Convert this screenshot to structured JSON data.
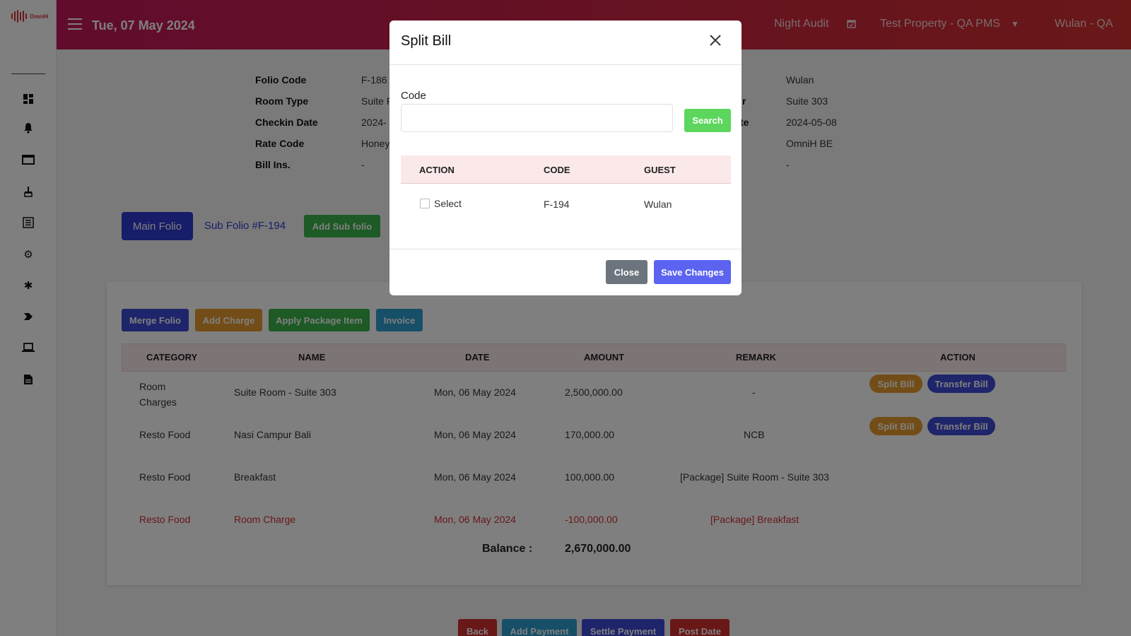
{
  "app": {
    "logo_text": "OmniH"
  },
  "topbar": {
    "date": "Tue, 07 May 2024",
    "night_audit": "Night Audit",
    "property": "Test Property - QA PMS",
    "user": "Wulan - QA"
  },
  "sidebar": {
    "icons": [
      "dashboard-icon",
      "bell-icon",
      "folder-icon",
      "broom-icon",
      "list-icon",
      "gear-icon",
      "network-icon",
      "tag-icon",
      "laptop-icon",
      "report-icon"
    ]
  },
  "folio_info": {
    "left": [
      {
        "label": "Folio Code",
        "value": "F-186"
      },
      {
        "label": "Room Type",
        "value": "Suite R"
      },
      {
        "label": "Checkin Date",
        "value": "2024-"
      },
      {
        "label": "Rate Code",
        "value": "Honey"
      },
      {
        "label": "Bill Ins.",
        "value": "-"
      }
    ],
    "right": [
      {
        "label": "r",
        "value": "Wulan"
      },
      {
        "label": "r",
        "value": "Suite 303"
      },
      {
        "label": "te",
        "value": "2024-05-08"
      },
      {
        "label": "",
        "value": "OmniH BE"
      },
      {
        "label": "",
        "value": "-"
      }
    ]
  },
  "tabs": {
    "main": "Main Folio",
    "sub": "Sub Folio #F-194",
    "add_sub": "Add Sub folio"
  },
  "actions": {
    "merge": "Merge Folio",
    "add_charge": "Add Charge",
    "apply_package": "Apply Package Item",
    "invoice": "Invoice"
  },
  "table": {
    "headers": [
      "CATEGORY",
      "NAME",
      "DATE",
      "AMOUNT",
      "REMARK",
      "ACTION"
    ],
    "rows": [
      {
        "category": "Room\nCharges",
        "name": "Suite Room - Suite 303",
        "date": "Mon, 06 May 2024",
        "amount": "2,500,000.00",
        "remark": "-",
        "split": "Split Bill",
        "transfer": "Transfer Bill"
      },
      {
        "category": "Resto Food",
        "name": "Nasi Campur Bali",
        "date": "Mon, 06 May 2024",
        "amount": "170,000.00",
        "remark": "NCB",
        "split": "Split Bill",
        "transfer": "Transfer Bill"
      },
      {
        "category": "Resto Food",
        "name": "Breakfast",
        "date": "Mon, 06 May 2024",
        "amount": "100,000.00",
        "remark": "[Package] Suite Room - Suite 303"
      },
      {
        "category": "Resto Food",
        "name": "Room Charge",
        "date": "Mon, 06 May 2024",
        "amount": "-100,000.00",
        "remark": "[Package] Breakfast"
      }
    ],
    "balance_label": "Balance :",
    "balance_value": "2,670,000.00"
  },
  "bottom_buttons": {
    "back": "Back",
    "add_payment": "Add Payment",
    "settle_payment": "Settle Payment",
    "post_date": "Post Date"
  },
  "modal": {
    "title": "Split Bill",
    "code_label": "Code",
    "code_value": "",
    "search": "Search",
    "headers": [
      "ACTION",
      "CODE",
      "GUEST"
    ],
    "row": {
      "select_label": "Select",
      "code": "F-194",
      "guest": "Wulan"
    },
    "close": "Close",
    "save": "Save Changes"
  },
  "colors": {
    "topbar_start": "#c2185b",
    "topbar_end": "#d32f2f",
    "primary": "#2e3bd1",
    "success": "#3bb54a",
    "warning": "#e69a2e",
    "info": "#2e9fd1",
    "danger": "#d32f2f"
  }
}
